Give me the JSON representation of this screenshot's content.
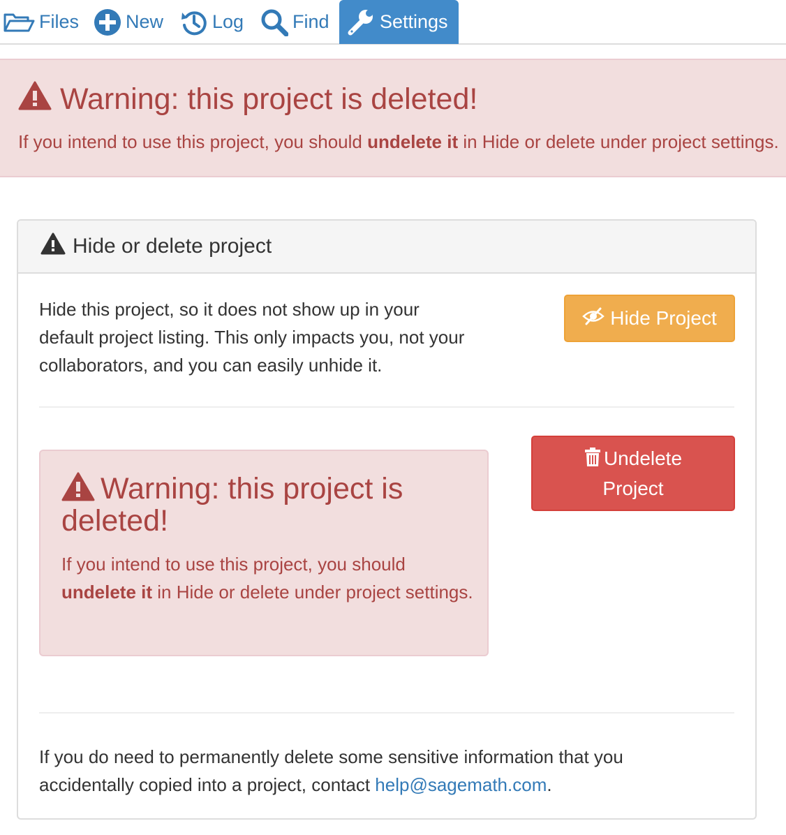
{
  "nav": {
    "tabs": [
      {
        "label": "Files",
        "icon": "folder-open-icon"
      },
      {
        "label": "New",
        "icon": "plus-circle-icon"
      },
      {
        "label": "Log",
        "icon": "history-icon"
      },
      {
        "label": "Find",
        "icon": "search-icon"
      },
      {
        "label": "Settings",
        "icon": "wrench-icon",
        "active": true
      }
    ]
  },
  "banner": {
    "title": "Warning: this project is deleted!",
    "message_pre": "If you intend to use this project, you should ",
    "message_bold": "undelete it",
    "message_post": " in Hide or delete under project settings."
  },
  "panel": {
    "title": "Hide or delete project",
    "hide_description": "Hide this project, so it does not show up in your default project listing. This only impacts you, not your collaborators, and you can easily unhide it.",
    "hide_button": "Hide Project",
    "undelete_button": "Undelete Project",
    "alert": {
      "title": "Warning: this project is deleted!",
      "message_pre": "If you intend to use this project, you should ",
      "message_bold": "undelete it",
      "message_post": " in Hide or delete under project settings."
    },
    "footer_text": "If you do need to permanently delete some sensitive information that you accidentally copied into a project, contact ",
    "footer_link": "help@sagemath.com",
    "footer_end": "."
  },
  "colors": {
    "link": "#337ab7",
    "active_tab": "#428bca",
    "danger_bg": "#f2dede",
    "danger_text": "#a94442",
    "warning_button": "#f0ad4e",
    "danger_button": "#d9534f"
  }
}
